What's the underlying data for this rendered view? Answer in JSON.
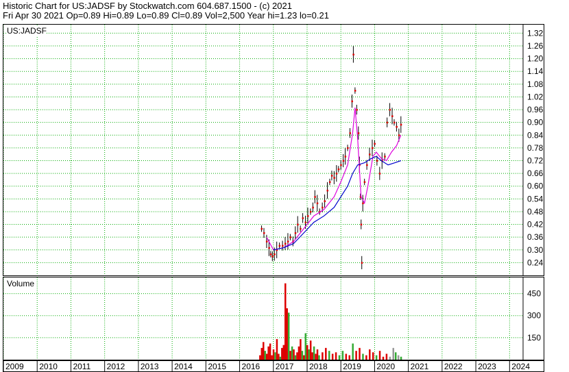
{
  "header": {
    "line1": "Historic Chart for US:JADSF by Stockwatch.com 604.687.1500 - (c) 2021",
    "line2": "Fri Apr 30 2021  Op=0.89  Hi=0.89  Lo=0.89  Cl=0.89  Vol=2,500  Year hi=1.23  lo=0.21"
  },
  "price_label": "US:JADSF",
  "volume_label": "Volume",
  "colors": {
    "price_bar": "#000000",
    "marker": "#e00000",
    "ma_short": "#dd00dd",
    "ma_long": "#0000cc",
    "vol_up": "#33aa33",
    "vol_down": "#dd0000",
    "vol_flat": "#999999",
    "grid": "#00aa00"
  },
  "chart_data": [
    {
      "type": "line",
      "title": "US:JADSF",
      "y_ticks": [
        "1.32",
        "1.26",
        "1.20",
        "1.14",
        "1.08",
        "1.02",
        "0.96",
        "0.90",
        "0.84",
        "0.78",
        "0.72",
        "0.66",
        "0.60",
        "0.54",
        "0.48",
        "0.42",
        "0.36",
        "0.30",
        "0.24"
      ],
      "ylim": [
        0.18,
        1.36
      ],
      "x_ticks": [
        "2009",
        "2010",
        "2011",
        "2012",
        "2013",
        "2014",
        "2015",
        "2016",
        "2017",
        "2018",
        "2019",
        "2020",
        "2021",
        "2022",
        "2023",
        "2024"
      ],
      "xlim": [
        2009.0,
        2024.4
      ],
      "series": [
        {
          "kind": "price",
          "points": [
            [
              2016.65,
              0.4
            ],
            [
              2016.72,
              0.38
            ],
            [
              2016.8,
              0.34
            ],
            [
              2016.87,
              0.31
            ],
            [
              2016.92,
              0.28
            ],
            [
              2016.97,
              0.27
            ],
            [
              2017.03,
              0.28
            ],
            [
              2017.1,
              0.3
            ],
            [
              2017.18,
              0.32
            ],
            [
              2017.27,
              0.32
            ],
            [
              2017.35,
              0.33
            ],
            [
              2017.43,
              0.34
            ],
            [
              2017.5,
              0.36
            ],
            [
              2017.58,
              0.34
            ],
            [
              2017.65,
              0.38
            ],
            [
              2017.72,
              0.42
            ],
            [
              2017.8,
              0.4
            ],
            [
              2017.87,
              0.45
            ],
            [
              2017.95,
              0.43
            ],
            [
              2018.02,
              0.46
            ],
            [
              2018.1,
              0.48
            ],
            [
              2018.17,
              0.5
            ],
            [
              2018.23,
              0.55
            ],
            [
              2018.3,
              0.52
            ],
            [
              2018.37,
              0.48
            ],
            [
              2018.45,
              0.5
            ],
            [
              2018.52,
              0.53
            ],
            [
              2018.6,
              0.58
            ],
            [
              2018.67,
              0.62
            ],
            [
              2018.73,
              0.65
            ],
            [
              2018.8,
              0.64
            ],
            [
              2018.87,
              0.66
            ],
            [
              2018.93,
              0.68
            ],
            [
              2019.0,
              0.7
            ],
            [
              2019.07,
              0.72
            ],
            [
              2019.13,
              0.74
            ],
            [
              2019.2,
              0.78
            ],
            [
              2019.27,
              0.85
            ],
            [
              2019.33,
              1.0
            ],
            [
              2019.37,
              1.22
            ],
            [
              2019.42,
              1.05
            ],
            [
              2019.47,
              0.96
            ],
            [
              2019.52,
              0.85
            ],
            [
              2019.55,
              0.7
            ],
            [
              2019.58,
              0.55
            ],
            [
              2019.6,
              0.42
            ],
            [
              2019.62,
              0.24
            ],
            [
              2019.65,
              0.52
            ],
            [
              2019.7,
              0.62
            ],
            [
              2019.77,
              0.7
            ],
            [
              2019.85,
              0.75
            ],
            [
              2019.93,
              0.78
            ],
            [
              2020.0,
              0.8
            ],
            [
              2020.07,
              0.72
            ],
            [
              2020.15,
              0.66
            ],
            [
              2020.22,
              0.72
            ],
            [
              2020.3,
              0.74
            ],
            [
              2020.37,
              0.9
            ],
            [
              2020.45,
              0.96
            ],
            [
              2020.52,
              0.93
            ],
            [
              2020.58,
              0.9
            ],
            [
              2020.65,
              0.88
            ],
            [
              2020.72,
              0.84
            ],
            [
              2020.78,
              0.89
            ]
          ]
        },
        {
          "name": "",
          "kind": "ma_short",
          "points": [
            [
              2016.8,
              0.36
            ],
            [
              2017.0,
              0.3
            ],
            [
              2017.3,
              0.31
            ],
            [
              2017.6,
              0.34
            ],
            [
              2017.9,
              0.4
            ],
            [
              2018.2,
              0.46
            ],
            [
              2018.5,
              0.49
            ],
            [
              2018.8,
              0.55
            ],
            [
              2019.0,
              0.62
            ],
            [
              2019.2,
              0.7
            ],
            [
              2019.35,
              0.85
            ],
            [
              2019.42,
              0.97
            ],
            [
              2019.5,
              0.82
            ],
            [
              2019.6,
              0.55
            ],
            [
              2019.7,
              0.52
            ],
            [
              2019.8,
              0.6
            ],
            [
              2019.95,
              0.74
            ],
            [
              2020.05,
              0.76
            ],
            [
              2020.2,
              0.73
            ],
            [
              2020.35,
              0.72
            ],
            [
              2020.5,
              0.76
            ],
            [
              2020.65,
              0.79
            ],
            [
              2020.78,
              0.84
            ]
          ]
        },
        {
          "name": "",
          "kind": "ma_long",
          "points": [
            [
              2017.0,
              0.3
            ],
            [
              2017.3,
              0.31
            ],
            [
              2017.6,
              0.33
            ],
            [
              2017.9,
              0.38
            ],
            [
              2018.2,
              0.43
            ],
            [
              2018.5,
              0.46
            ],
            [
              2018.8,
              0.5
            ],
            [
              2019.0,
              0.55
            ],
            [
              2019.2,
              0.6
            ],
            [
              2019.35,
              0.66
            ],
            [
              2019.5,
              0.7
            ],
            [
              2019.7,
              0.71
            ],
            [
              2019.9,
              0.73
            ],
            [
              2020.05,
              0.74
            ],
            [
              2020.2,
              0.72
            ],
            [
              2020.4,
              0.7
            ],
            [
              2020.6,
              0.71
            ],
            [
              2020.78,
              0.72
            ]
          ]
        }
      ]
    },
    {
      "type": "bar",
      "title": "Volume",
      "y_ticks": [
        "450 k",
        "300 k",
        "150 k"
      ],
      "ylim": [
        0,
        560000
      ],
      "values": [
        [
          2016.6,
          30000,
          "down"
        ],
        [
          2016.65,
          80000,
          "down"
        ],
        [
          2016.7,
          120000,
          "down"
        ],
        [
          2016.75,
          60000,
          "up"
        ],
        [
          2016.8,
          40000,
          "down"
        ],
        [
          2016.85,
          90000,
          "down"
        ],
        [
          2016.9,
          110000,
          "down"
        ],
        [
          2016.95,
          30000,
          "down"
        ],
        [
          2017.0,
          70000,
          "down"
        ],
        [
          2017.05,
          50000,
          "up"
        ],
        [
          2017.1,
          140000,
          "down"
        ],
        [
          2017.15,
          40000,
          "down"
        ],
        [
          2017.2,
          20000,
          "up"
        ],
        [
          2017.25,
          80000,
          "down"
        ],
        [
          2017.3,
          100000,
          "down"
        ],
        [
          2017.35,
          520000,
          "down"
        ],
        [
          2017.4,
          350000,
          "down"
        ],
        [
          2017.45,
          320000,
          "up"
        ],
        [
          2017.5,
          60000,
          "down"
        ],
        [
          2017.55,
          90000,
          "up"
        ],
        [
          2017.6,
          70000,
          "down"
        ],
        [
          2017.65,
          30000,
          "up"
        ],
        [
          2017.7,
          50000,
          "down"
        ],
        [
          2017.75,
          90000,
          "down"
        ],
        [
          2017.8,
          140000,
          "down"
        ],
        [
          2017.85,
          60000,
          "up"
        ],
        [
          2017.9,
          30000,
          "down"
        ],
        [
          2017.95,
          180000,
          "up"
        ],
        [
          2018.0,
          100000,
          "down"
        ],
        [
          2018.05,
          70000,
          "up"
        ],
        [
          2018.1,
          130000,
          "down"
        ],
        [
          2018.15,
          50000,
          "down"
        ],
        [
          2018.2,
          90000,
          "up"
        ],
        [
          2018.25,
          40000,
          "down"
        ],
        [
          2018.3,
          70000,
          "down"
        ],
        [
          2018.35,
          30000,
          "up"
        ],
        [
          2018.45,
          50000,
          "down"
        ],
        [
          2018.55,
          80000,
          "down"
        ],
        [
          2018.65,
          60000,
          "up"
        ],
        [
          2018.75,
          40000,
          "down"
        ],
        [
          2018.85,
          50000,
          "down"
        ],
        [
          2018.95,
          30000,
          "up"
        ],
        [
          2019.05,
          60000,
          "up"
        ],
        [
          2019.15,
          40000,
          "down"
        ],
        [
          2019.25,
          30000,
          "down"
        ],
        [
          2019.35,
          110000,
          "up"
        ],
        [
          2019.45,
          60000,
          "down"
        ],
        [
          2019.55,
          80000,
          "down"
        ],
        [
          2019.65,
          40000,
          "up"
        ],
        [
          2019.75,
          30000,
          "down"
        ],
        [
          2019.85,
          70000,
          "down"
        ],
        [
          2019.95,
          50000,
          "down"
        ],
        [
          2020.05,
          30000,
          "up"
        ],
        [
          2020.15,
          60000,
          "down"
        ],
        [
          2020.25,
          20000,
          "down"
        ],
        [
          2020.35,
          40000,
          "down"
        ],
        [
          2020.45,
          20000,
          "flat"
        ],
        [
          2020.55,
          80000,
          "flat"
        ],
        [
          2020.62,
          50000,
          "up"
        ],
        [
          2020.7,
          30000,
          "flat"
        ],
        [
          2020.78,
          20000,
          "up"
        ]
      ]
    }
  ]
}
